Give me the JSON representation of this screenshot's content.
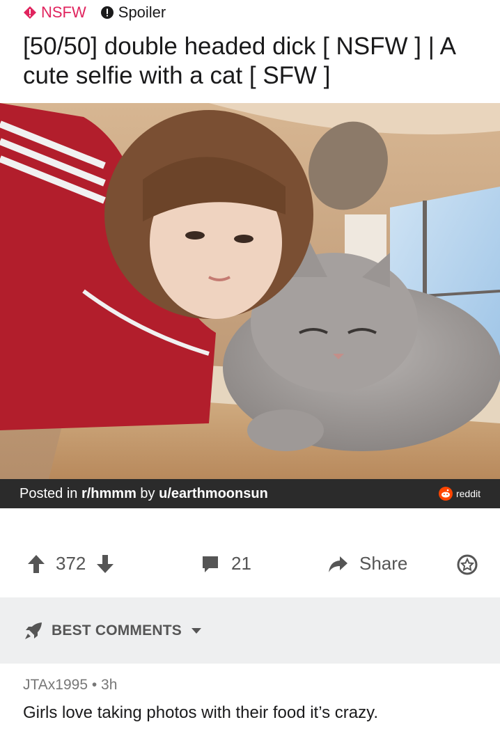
{
  "post": {
    "tags": {
      "nsfw_label": "NSFW",
      "spoiler_label": "Spoiler"
    },
    "title": "[50/50] double headed dick [ NSFW ] | A cute selfie with a cat [ SFW ]"
  },
  "image_caption": {
    "prefix": "Posted in ",
    "subreddit": "r/hmmm",
    "by": " by ",
    "user": "u/earthmoonsun",
    "brand": "reddit"
  },
  "actions": {
    "upvotes": "372",
    "comments": "21",
    "share_label": "Share"
  },
  "sort": {
    "label": "BEST COMMENTS"
  },
  "top_comment": {
    "author": "JTAx1995",
    "separator": " • ",
    "age": "3h",
    "body": "Girls love taking photos with their food it’s crazy."
  },
  "colors": {
    "nsfw": "#e0245e",
    "reddit_orange": "#ff4500",
    "caption_bg": "#2b2b2b",
    "sort_bg": "#eeeff0",
    "icon_gray": "#555555"
  },
  "icons": [
    "nsfw-diamond-icon",
    "spoiler-alert-icon",
    "reddit-logo-icon",
    "upvote-icon",
    "downvote-icon",
    "comment-icon",
    "share-icon",
    "award-icon",
    "rocket-icon",
    "chevron-down-icon"
  ]
}
